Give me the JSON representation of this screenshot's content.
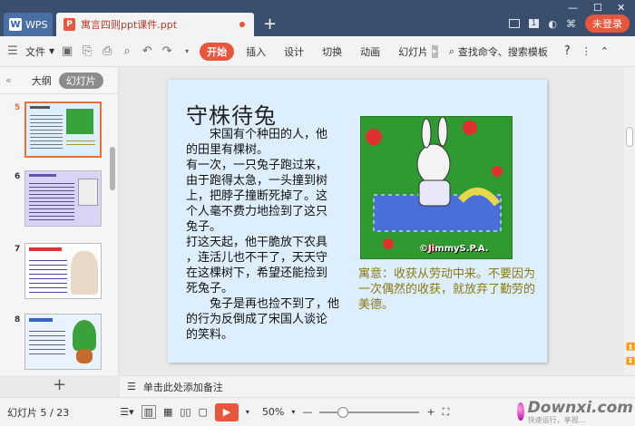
{
  "titlebar": {
    "app_tab_label": "WPS",
    "doc_tab_label": "寓言四则ppt课件.ppt",
    "new_tab_symbol": "+",
    "login_label": "未登录",
    "badge": "1"
  },
  "toolbar": {
    "file_label": "文件",
    "start_label": "开始",
    "tabs": [
      "插入",
      "设计",
      "切换",
      "动画",
      "幻灯片"
    ],
    "search_label": "查找命令、搜索模板",
    "help": "?"
  },
  "left_panel": {
    "tab_outline": "大纲",
    "tab_slides": "幻灯片",
    "slides": [
      {
        "num": "5"
      },
      {
        "num": "6"
      },
      {
        "num": "7"
      },
      {
        "num": "8"
      }
    ],
    "add_label": "+"
  },
  "slide": {
    "title": "守株待兔",
    "body": "　　宋国有个种田的人，他的田里有棵树。有一次，一只兔子跑过来，由于跑得太急，一头撞到树上，把脖子撞断死掉了。这个人毫不费力地捡到了这只兔子。打这天起，他干脆放下农具，连活儿也不干了，天天守在这棵树下，希望还能捡到死兔子。　　兔子是再也捡不到了，他的行为反倒成了宋国人谈论的笑料。",
    "body_lines": [
      "　　宋国有个种田的人，他",
      "的田里有棵树。",
      "有一次，一只兔子跑过来，",
      "由于跑得太急，一头撞到树",
      "上，把脖子撞断死掉了。这",
      "个人毫不费力地捡到了这只",
      "兔子。",
      "打这天起，他干脆放下农具",
      "，连活儿也不干了，天天守",
      "在这棵树下，希望还能捡到",
      "死兔子。",
      "　　兔子是再也捡不到了，他",
      "的行为反倒成了宋国人谈论",
      "的笑料。"
    ],
    "image_caption": "©JimmyS.P.A.",
    "note": "寓意：收获从劳动中来。不要因为一次偶然的收获，就放弃了勤劳的美德。"
  },
  "notes": {
    "placeholder": "单击此处添加备注"
  },
  "status": {
    "slide_counter": "幻灯片 5 / 23",
    "zoom": "50%",
    "watermark": "Downxi.com",
    "watermark_sub": "快速运行，享视..."
  },
  "colors": {
    "accent": "#e8563b",
    "titlebar": "#3a4e6d",
    "slide_bg": "#ddeefd",
    "note_text": "#8b7a10"
  }
}
